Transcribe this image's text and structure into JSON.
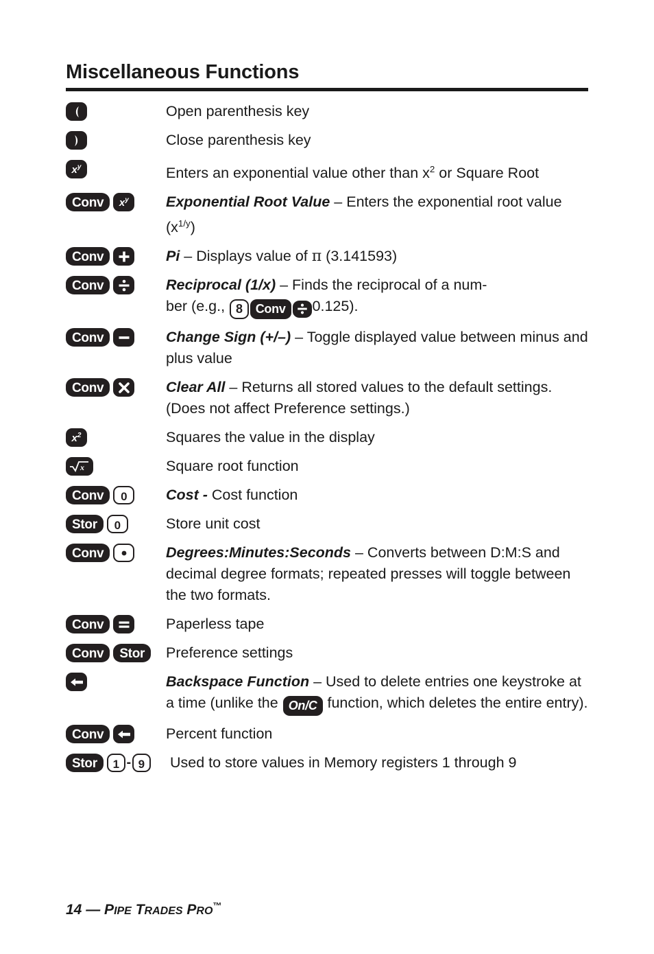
{
  "document": {
    "title": "Miscellaneous Functions",
    "footer": {
      "page_number": "14",
      "dash": "—",
      "product_p": "P",
      "product_ipe": "IPE",
      "product_t": "T",
      "product_rades": "RADES",
      "product_p2": "P",
      "product_ro": "RO",
      "trademark": "™"
    }
  },
  "rows": [
    {
      "keys": [
        {
          "label": "(",
          "style": "solid-square",
          "icon": "open-paren-key"
        }
      ],
      "desc_plain": "Open parenthesis key"
    },
    {
      "keys": [
        {
          "label": ")",
          "style": "solid-square",
          "icon": "close-paren-key"
        }
      ],
      "desc_plain": "Close parenthesis key"
    },
    {
      "keys": [
        {
          "label": "x^y",
          "style": "solid-square",
          "icon": "x-to-the-y-key"
        }
      ],
      "desc_plain": "Enters an exponential value other than x² or Square Root"
    },
    {
      "keys": [
        {
          "label": "Conv",
          "style": "solid-wide",
          "icon": "conv-key"
        },
        {
          "label": "x^y",
          "style": "solid-square",
          "icon": "x-to-the-y-key"
        }
      ],
      "desc_bold": "Exponential Root Value",
      "desc_rest": " – Enters the exponential root value (x1/y)"
    },
    {
      "keys": [
        {
          "label": "Conv",
          "style": "solid-wide",
          "icon": "conv-key"
        },
        {
          "label": "+",
          "style": "solid-square",
          "icon": "plus-key"
        }
      ],
      "desc_bold": "Pi",
      "desc_rest": " – Displays value of π (3.141593)"
    },
    {
      "keys": [
        {
          "label": "Conv",
          "style": "solid-wide",
          "icon": "conv-key"
        },
        {
          "label": "÷",
          "style": "solid-square",
          "icon": "divide-key"
        }
      ],
      "desc_bold": "Reciprocal (1/x)",
      "desc_rest": " – Finds the reciprocal of a number (e.g., 8 Conv ÷ 0.125).",
      "inline_keys": [
        "8",
        "Conv",
        "÷"
      ],
      "inline_tail": "0.125)."
    },
    {
      "keys": [
        {
          "label": "Conv",
          "style": "solid-wide",
          "icon": "conv-key"
        },
        {
          "label": "−",
          "style": "solid-square",
          "icon": "minus-key"
        }
      ],
      "desc_bold": "Change Sign (+/–)",
      "desc_rest": " – Toggle displayed value between minus and plus value"
    },
    {
      "keys": [
        {
          "label": "Conv",
          "style": "solid-wide",
          "icon": "conv-key"
        },
        {
          "label": "✕",
          "style": "solid-square",
          "icon": "multiply-key"
        }
      ],
      "desc_bold": "Clear All",
      "desc_rest": " – Returns all stored values to the default settings. (Does not affect Preference settings.)"
    },
    {
      "keys": [
        {
          "label": "x²",
          "style": "solid-square",
          "icon": "x-squared-key"
        }
      ],
      "desc_plain": "Squares the value in the display"
    },
    {
      "keys": [
        {
          "label": "√x",
          "style": "solid-square",
          "icon": "square-root-key"
        }
      ],
      "desc_plain": "Square root function"
    },
    {
      "keys": [
        {
          "label": "Conv",
          "style": "solid-wide",
          "icon": "conv-key"
        },
        {
          "label": "0",
          "style": "outline-square",
          "icon": "zero-key"
        }
      ],
      "desc_bold": "Cost -",
      "desc_rest": " Cost function"
    },
    {
      "keys": [
        {
          "label": "Stor",
          "style": "solid-wide",
          "icon": "stor-key"
        },
        {
          "label": "0",
          "style": "outline-square",
          "icon": "zero-key"
        }
      ],
      "desc_plain": "Store unit cost"
    },
    {
      "keys": [
        {
          "label": "Conv",
          "style": "solid-wide",
          "icon": "conv-key"
        },
        {
          "label": "•",
          "style": "outline-square",
          "icon": "decimal-point-key"
        }
      ],
      "desc_bold": "Degrees:Minutes:Seconds",
      "desc_rest": " – Converts between D:M:S and decimal degree formats; repeated presses will toggle between the two formats."
    },
    {
      "keys": [
        {
          "label": "Conv",
          "style": "solid-wide",
          "icon": "conv-key"
        },
        {
          "label": "=",
          "style": "solid-square",
          "icon": "equals-key"
        }
      ],
      "desc_plain": "Paperless tape"
    },
    {
      "keys": [
        {
          "label": "Conv",
          "style": "solid-wide",
          "icon": "conv-key"
        },
        {
          "label": "Stor",
          "style": "solid-wide",
          "icon": "stor-key"
        }
      ],
      "desc_plain": "Preference settings"
    },
    {
      "keys": [
        {
          "label": "←",
          "style": "solid-square",
          "icon": "backspace-key"
        }
      ],
      "desc_bold": "Backspace Function",
      "desc_rest": " – Used to delete entries one keystroke at a time (unlike the On/C function, which deletes the entire entry).",
      "inline_keys": [
        "On/C"
      ]
    },
    {
      "keys": [
        {
          "label": "Conv",
          "style": "solid-wide",
          "icon": "conv-key"
        },
        {
          "label": "←",
          "style": "solid-square",
          "icon": "backspace-key"
        }
      ],
      "desc_plain": "Percent function"
    },
    {
      "keys": [
        {
          "label": "Stor",
          "style": "solid-wide",
          "icon": "stor-key"
        },
        {
          "label": "1",
          "style": "outline-square",
          "icon": "one-key"
        },
        {
          "label": "-",
          "style": "separator",
          "icon": "range-dash"
        },
        {
          "label": "9",
          "style": "outline-square",
          "icon": "nine-key"
        }
      ],
      "desc_plain": "Used to store values in Memory registers 1 through 9"
    }
  ],
  "text": {
    "r1_desc": "Open parenthesis key",
    "r2_desc": "Close parenthesis key",
    "r3_desc_a": "Enters an exponential value other than x",
    "r3_sup": "2",
    "r3_desc_b": " or Square Root",
    "r4_bold": "Exponential Root Value",
    "r4_rest_a": " – Enters the exponential root value (x",
    "r4_sup": "1/y",
    "r4_rest_b": ")",
    "r5_bold": "Pi",
    "r5_rest_a": " – Displays value of ",
    "r5_pi": "π",
    "r5_rest_b": " (3.141593)",
    "r6_bold": "Reciprocal (1/x)",
    "r6_rest_a": " – Finds the reciprocal of a num-ber (e.g., ",
    "r6_k1": "8",
    "r6_k2": "Conv",
    "r6_rest_b": "0.125).",
    "r7_bold": "Change Sign (+/–)",
    "r7_rest": " – Toggle displayed value between minus and plus value",
    "r8_bold": "Clear All",
    "r8_rest": " – Returns all stored values to the default settings. (Does not affect Preference settings.)",
    "r9_desc": "Squares the value in the display",
    "r10_desc": "Square root function",
    "r11_bold": "Cost -",
    "r11_rest": " Cost function",
    "r12_desc": "Store unit cost",
    "r13_bold": "Degrees:Minutes:Seconds",
    "r13_rest": " – Converts between D:M:S and decimal degree formats; repeated presses will toggle between the two formats.",
    "r14_desc": "Paperless tape",
    "r15_desc": "Preference settings",
    "r16_bold": "Backspace Function",
    "r16_rest_a": " – Used to delete entries one keystroke at a time (unlike the ",
    "r16_key": "On/C",
    "r16_rest_b": " function, which deletes the entire entry).",
    "r17_desc": "Percent function",
    "r18_desc": "Used to store values in Memory registers 1 through 9"
  },
  "keys": {
    "conv": "Conv",
    "stor": "Stor",
    "zero": "0",
    "one": "1",
    "nine": "9",
    "eight": "8",
    "onc": "On/C",
    "dash": "-",
    "x": "x",
    "y": "y",
    "two": "2"
  },
  "colors": {
    "ink": "#231f20",
    "paper": "#ffffff"
  }
}
